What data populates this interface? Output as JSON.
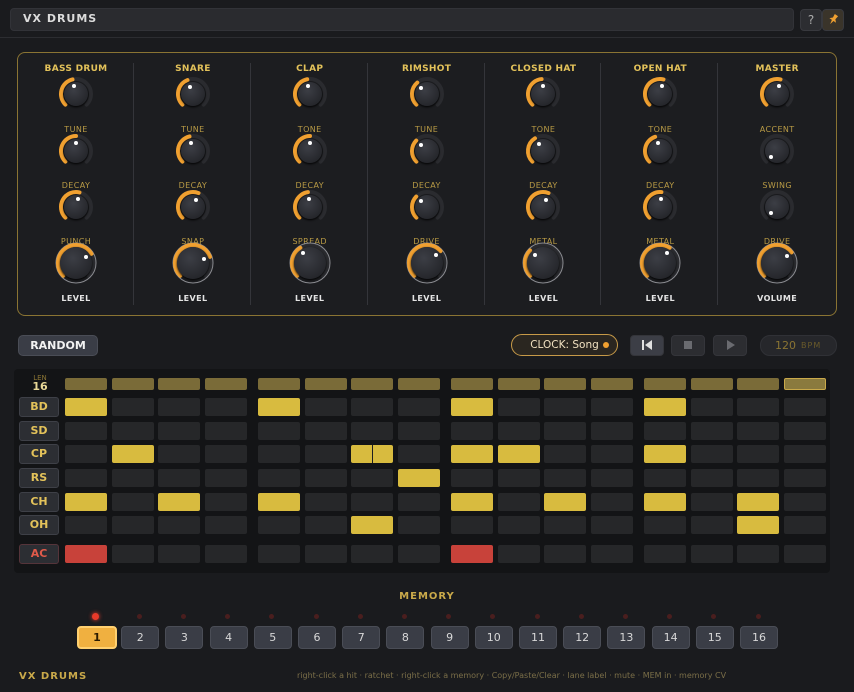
{
  "app": {
    "title": "VX DRUMS",
    "help_label": "?"
  },
  "colors": {
    "accent": "#d8bb3f",
    "led": "#e83a2a",
    "selected_memory": "#f0b040",
    "panel_border": "#8a7433"
  },
  "instruments": [
    {
      "name": "BASS DRUM",
      "params": [
        "TUNE",
        "DECAY",
        "PUNCH"
      ],
      "level_label": "LEVEL"
    },
    {
      "name": "SNARE",
      "params": [
        "TUNE",
        "DECAY",
        "SNAP"
      ],
      "level_label": "LEVEL"
    },
    {
      "name": "CLAP",
      "params": [
        "TONE",
        "DECAY",
        "SPREAD"
      ],
      "level_label": "LEVEL"
    },
    {
      "name": "RIMSHOT",
      "params": [
        "TUNE",
        "DECAY",
        "DRIVE"
      ],
      "level_label": "LEVEL"
    },
    {
      "name": "CLOSED HAT",
      "params": [
        "TONE",
        "DECAY",
        "METAL"
      ],
      "level_label": "LEVEL"
    },
    {
      "name": "OPEN HAT",
      "params": [
        "TONE",
        "DECAY",
        "METAL"
      ],
      "level_label": "LEVEL"
    },
    {
      "name": "MASTER",
      "params": [
        "ACCENT",
        "SWING",
        "DRIVE"
      ],
      "level_label": "VOLUME"
    }
  ],
  "knob_values": [
    [
      0.45,
      0.5,
      0.55,
      0.72
    ],
    [
      0.42,
      0.45,
      0.58,
      0.76
    ],
    [
      0.46,
      0.5,
      0.47,
      0.38
    ],
    [
      0.35,
      0.33,
      0.33,
      0.68
    ],
    [
      0.48,
      0.38,
      0.58,
      0.33
    ],
    [
      0.55,
      0.43,
      0.52,
      0.62
    ],
    [
      0.55,
      0.0,
      0.0,
      0.7
    ]
  ],
  "toolbar": {
    "random_label": "RANDOM",
    "clock_label": "CLOCK: Song",
    "transport": [
      "rewind-icon",
      "stop-icon",
      "play-icon"
    ],
    "bpm_value": "120",
    "bpm_unit": "BPM"
  },
  "sequencer": {
    "len_label": "LEN",
    "length": "16",
    "steps": 16,
    "lanes": [
      {
        "label": "BD",
        "steps": [
          1,
          0,
          0,
          0,
          1,
          0,
          0,
          0,
          1,
          0,
          0,
          0,
          1,
          0,
          0,
          0
        ]
      },
      {
        "label": "SD",
        "steps": [
          0,
          0,
          0,
          0,
          0,
          0,
          0,
          0,
          0,
          0,
          0,
          0,
          0,
          0,
          0,
          0
        ]
      },
      {
        "label": "CP",
        "steps": [
          0,
          1,
          0,
          0,
          0,
          0,
          2,
          0,
          1,
          1,
          0,
          0,
          1,
          0,
          0,
          0
        ]
      },
      {
        "label": "RS",
        "steps": [
          0,
          0,
          0,
          0,
          0,
          0,
          0,
          1,
          0,
          0,
          0,
          0,
          0,
          0,
          0,
          0
        ]
      },
      {
        "label": "CH",
        "steps": [
          1,
          0,
          1,
          0,
          1,
          0,
          0,
          0,
          1,
          0,
          1,
          0,
          1,
          0,
          1,
          0
        ]
      },
      {
        "label": "OH",
        "steps": [
          0,
          0,
          0,
          0,
          0,
          0,
          1,
          0,
          0,
          0,
          0,
          0,
          0,
          0,
          1,
          0
        ]
      },
      {
        "label": "AC",
        "steps": [
          1,
          0,
          0,
          0,
          0,
          0,
          0,
          0,
          1,
          0,
          0,
          0,
          0,
          0,
          0,
          0
        ]
      }
    ]
  },
  "memory": {
    "label": "MEMORY",
    "slots": [
      "1",
      "2",
      "3",
      "4",
      "5",
      "6",
      "7",
      "8",
      "9",
      "10",
      "11",
      "12",
      "13",
      "14",
      "15",
      "16"
    ],
    "selected": 1
  },
  "footer": {
    "brand": "VX DRUMS",
    "help_text": "right-click a hit · ratchet · right-click a memory · Copy/Paste/Clear · lane label · mute · MEM in · memory CV"
  }
}
